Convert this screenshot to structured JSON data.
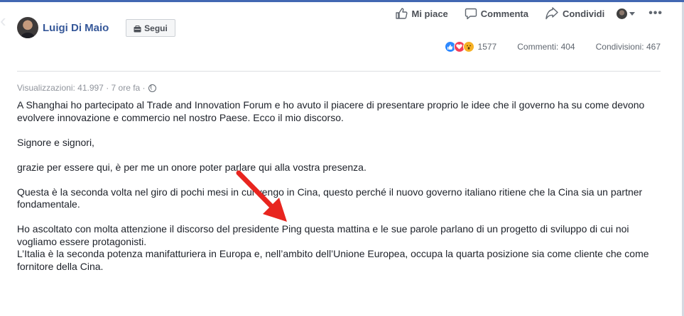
{
  "author": {
    "name": "Luigi Di Maio",
    "follow_label": "Segui"
  },
  "actions": {
    "like": "Mi piace",
    "comment": "Commenta",
    "share": "Condividi",
    "more": "•••"
  },
  "stats": {
    "reactions": "1577",
    "comments": "Commenti: 404",
    "shares": "Condivisioni: 467"
  },
  "meta": {
    "views": "Visualizzazioni: 41.997 · 7 ore fa ·"
  },
  "post": {
    "paragraphs": [
      "A Shanghai ho partecipato al Trade and Innovation Forum e ho avuto il piacere di presentare proprio le idee che il governo ha su come devono evolvere innovazione e commercio nel nostro Paese. Ecco il mio discorso.",
      "Signore e signori,",
      "grazie per essere qui, è per me un onore poter parlare qui alla vostra presenza.",
      "Questa è la seconda volta nel giro di pochi mesi in cui vengo in Cina, questo perché il nuovo governo italiano ritiene che la Cina sia un partner fondamentale.",
      "Ho ascoltato con molta attenzione il discorso del presidente Ping questa mattina e le sue parole parlano di un progetto di sviluppo di cui noi vogliamo essere protagonisti.",
      "L’Italia è la seconda potenza manifatturiera in Europa e, nell’ambito dell’Unione Europea, occupa la quarta posizione sia come cliente che come fornitore della Cina."
    ]
  },
  "colors": {
    "brand": "#4267b2",
    "link": "#365899",
    "annotation_arrow": "#e8251f"
  },
  "icons": [
    "like-icon",
    "comment-icon",
    "share-icon",
    "globe-icon",
    "follow-icon",
    "more-icon",
    "annotation-arrow"
  ]
}
